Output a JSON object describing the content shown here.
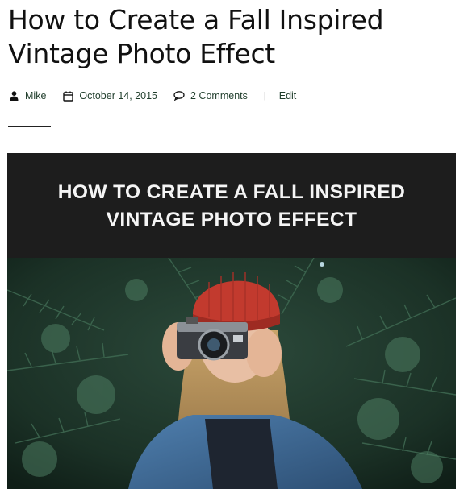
{
  "post": {
    "title": "How to Create a Fall Inspired Vintage Photo Effect",
    "meta": {
      "author": "Mike",
      "author_icon": "user-icon",
      "date": "October 14, 2015",
      "date_icon": "calendar-icon",
      "comments": "2 Comments",
      "comments_icon": "comment-icon",
      "separator": "|",
      "edit": "Edit"
    },
    "featured_image": {
      "banner_text": "HOW TO CREATE A FALL INSPIRED VINTAGE PHOTO EFFECT",
      "banner_color": "#1d1d1d",
      "foliage_color": "#1f3a2c",
      "hat_color": "#c23a2e",
      "jacket_color": "#3f6f9e"
    }
  },
  "colors": {
    "title": "#111111",
    "meta_link": "#1f3d2b",
    "accent_rule": "#222222"
  }
}
